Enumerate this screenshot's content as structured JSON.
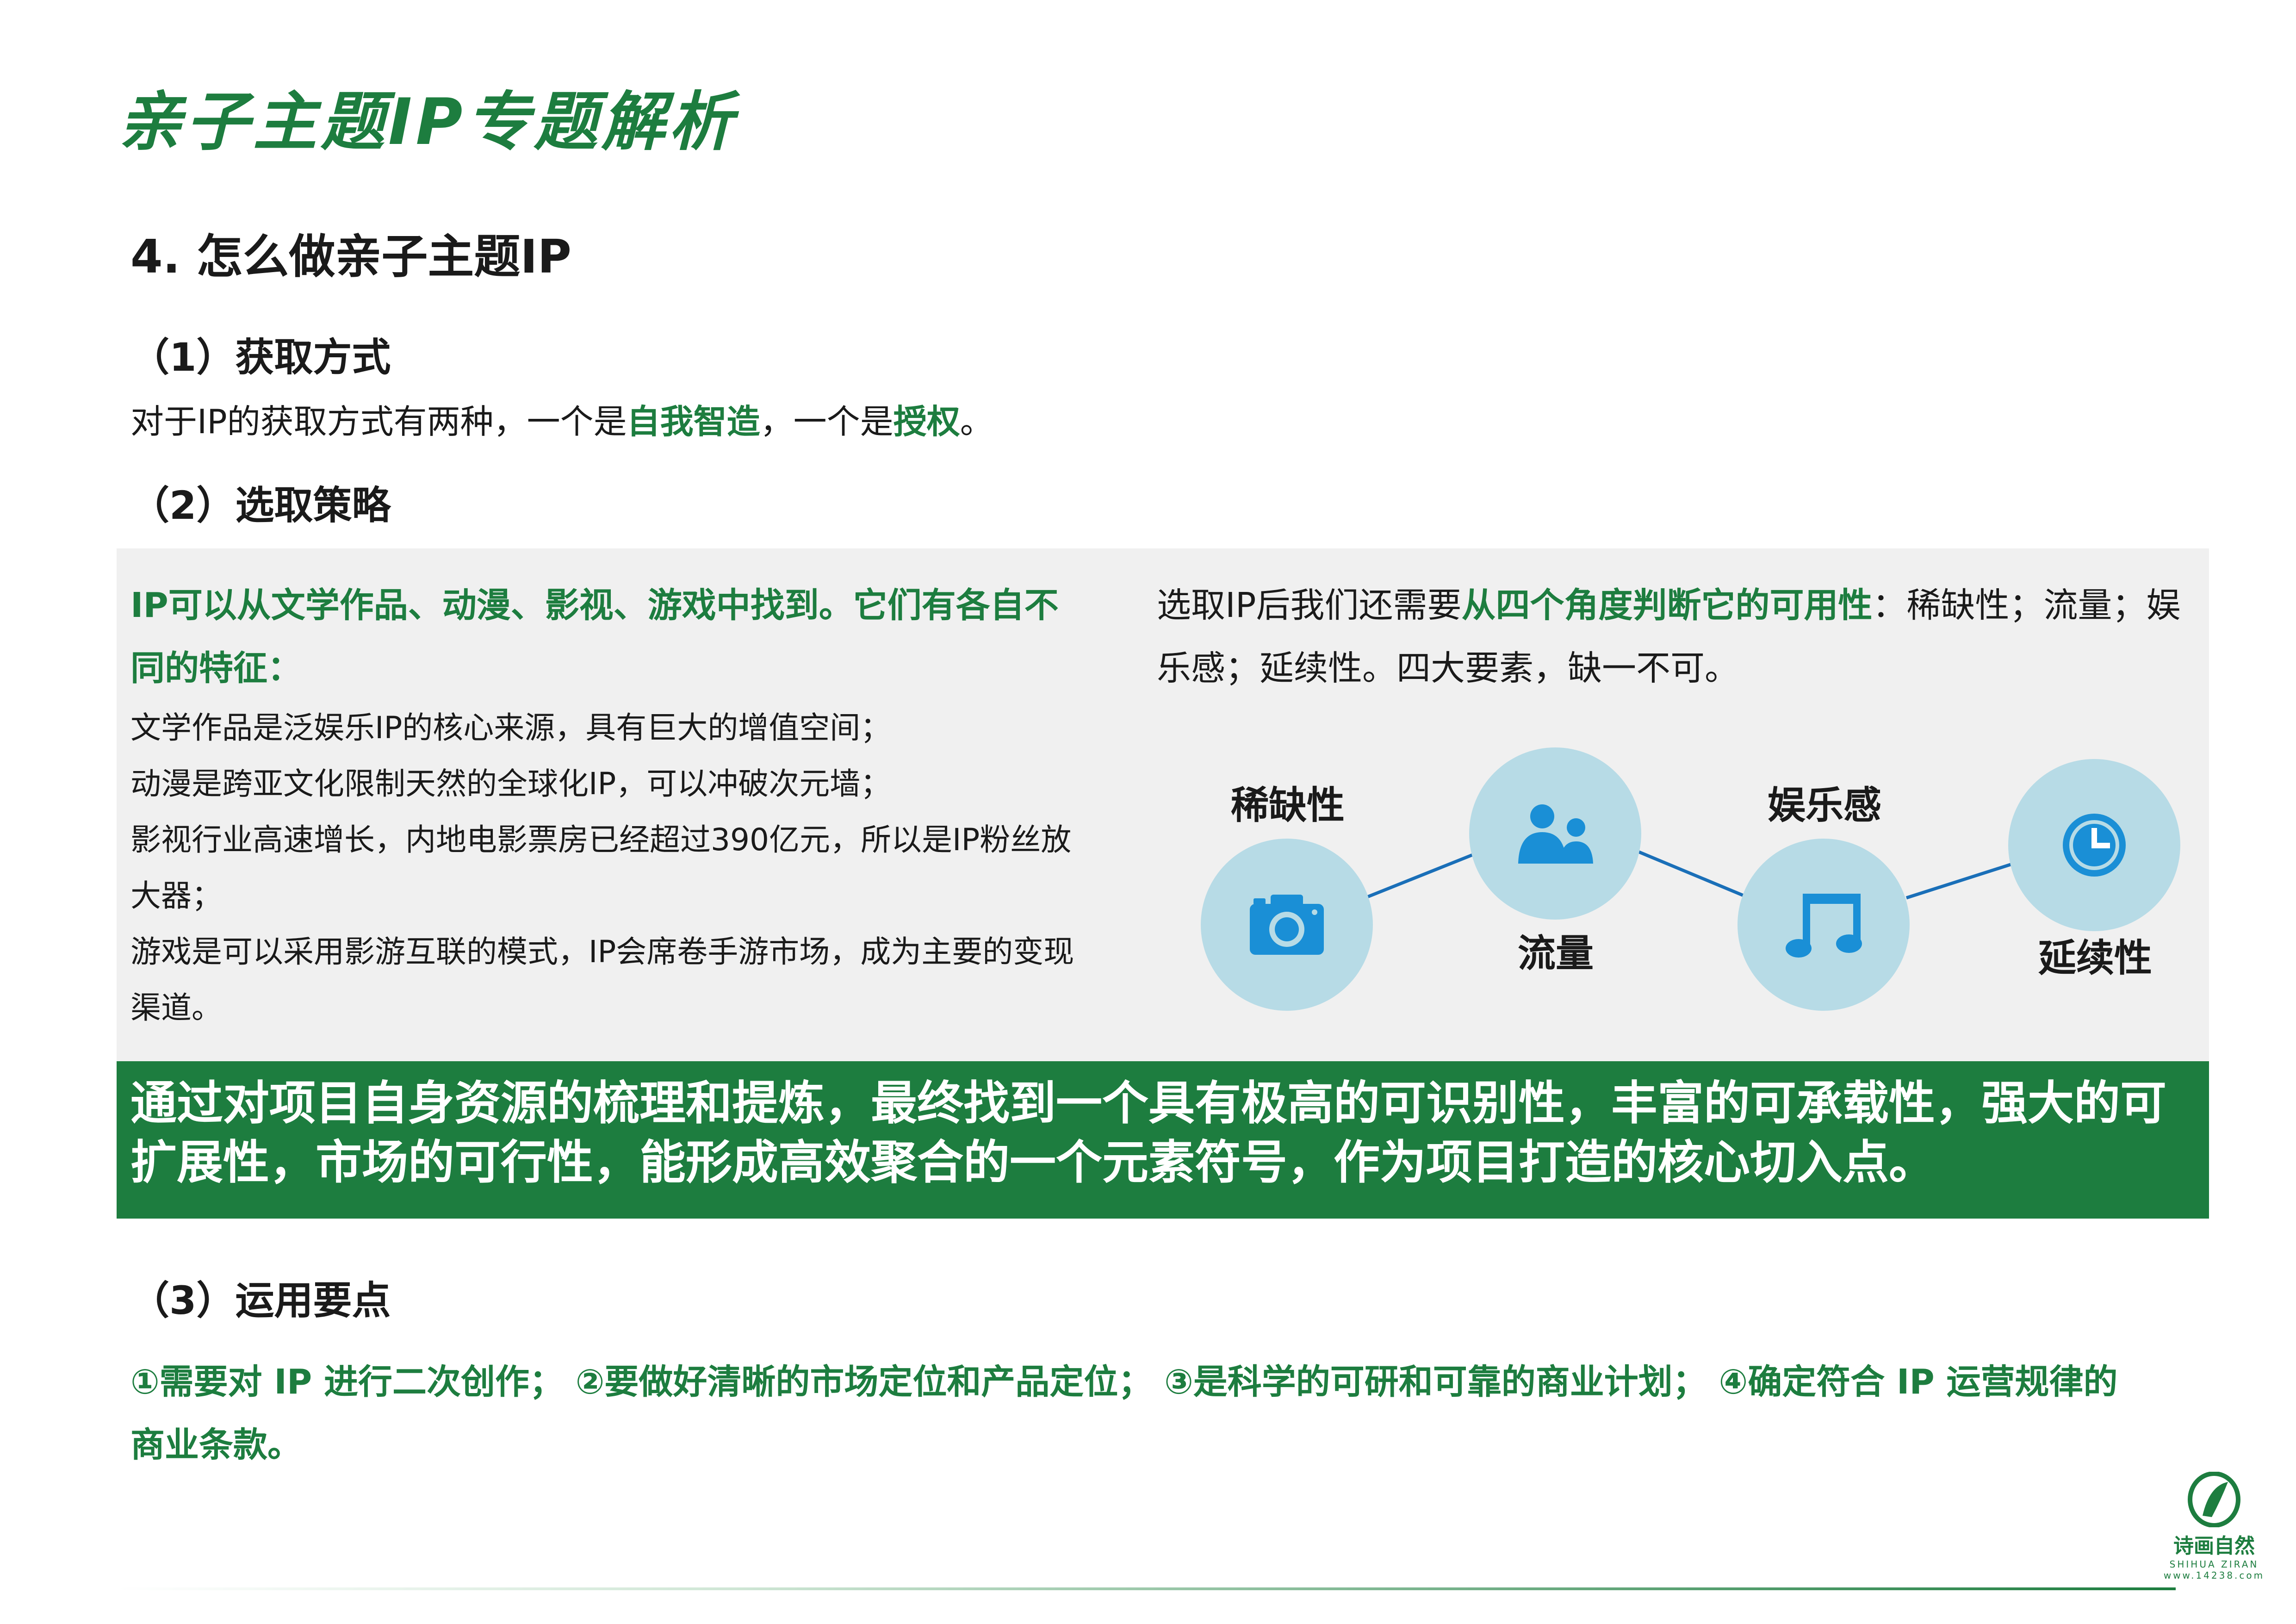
{
  "title": "亲子主题IP专题解析",
  "heading": "4. 怎么做亲子主题IP",
  "section1": {
    "heading": "（1）获取方式",
    "text_a": "对于IP的获取方式有两种，一个是",
    "highlight_a": "自我智造",
    "text_b": "，一个是",
    "highlight_b": "授权",
    "text_c": "。"
  },
  "section2": {
    "heading": "（2）选取策略",
    "left_head_1": "IP可以从文学作品、动漫、影视、游戏中找到。它们有各自不",
    "left_head_2": "同的特征：",
    "items": [
      "文学作品是泛娱乐IP的核心来源，具有巨大的增值空间；",
      "动漫是跨亚文化限制天然的全球化IP，可以冲破次元墙；",
      "影视行业高速增长，内地电影票房已经超过390亿元，所以是IP粉丝放",
      "大器；",
      "游戏是可以采用影游互联的模式，IP会席卷手游市场，成为主要的变现",
      "渠道。"
    ],
    "right_text_a": "选取IP后我们还需要",
    "right_highlight": "从四个角度判断它的可用性",
    "right_text_b": "：稀缺性；流量；娱乐感；延续性。四大要素，缺一不可。",
    "factors": [
      {
        "label": "稀缺性",
        "icon": "camera-icon"
      },
      {
        "label": "流量",
        "icon": "users-icon"
      },
      {
        "label": "娱乐感",
        "icon": "music-note-icon"
      },
      {
        "label": "延续性",
        "icon": "clock-icon"
      }
    ]
  },
  "banner": {
    "line1": "通过对项目自身资源的梳理和提炼，最终找到一个具有极高的可识别性，丰富的可承载性，强大的可",
    "line2": "扩展性，市场的可行性，能形成高效聚合的一个元素符号，作为项目打造的核心切入点。"
  },
  "section3": {
    "heading": "（3）运用要点",
    "line1": "①需要对 IP 进行二次创作； ②要做好清晰的市场定位和产品定位； ③是科学的可研和可靠的商业计划； ④确定符合 IP 运营规律的",
    "line2": "商业条款。"
  },
  "logo": {
    "name": "诗画自然",
    "sub": "SHIHUA ZIRAN",
    "url": "www.14238.com"
  },
  "colors": {
    "brand_green": "#1d7d3f",
    "circle_blue": "#b7dbe6",
    "icon_blue": "#1a8fd6",
    "panel_gray": "#f0f0f0"
  }
}
